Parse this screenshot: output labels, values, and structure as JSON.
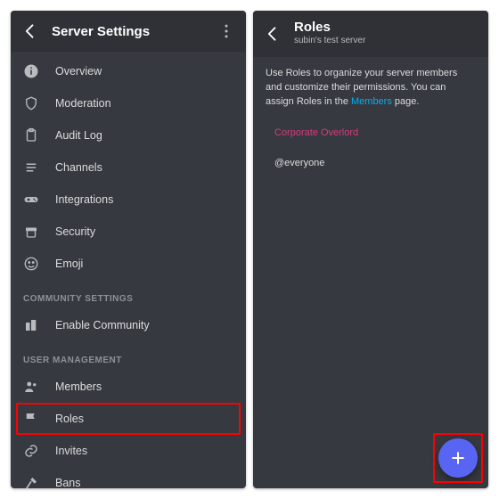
{
  "left": {
    "title": "Server Settings",
    "items": {
      "overview": "Overview",
      "moderation": "Moderation",
      "auditlog": "Audit Log",
      "channels": "Channels",
      "integrations": "Integrations",
      "security": "Security",
      "emoji": "Emoji"
    },
    "section_community": "COMMUNITY SETTINGS",
    "community": {
      "enable": "Enable Community"
    },
    "section_user": "USER MANAGEMENT",
    "user": {
      "members": "Members",
      "roles": "Roles",
      "invites": "Invites",
      "bans": "Bans"
    }
  },
  "right": {
    "title": "Roles",
    "subtitle": "subin's test server",
    "intro_a": "Use Roles to organize your server members and customize their permissions. You can assign Roles in the ",
    "intro_link": "Members",
    "intro_b": " page.",
    "roles": {
      "r0": "Corporate Overlord",
      "r1": "@everyone"
    }
  }
}
